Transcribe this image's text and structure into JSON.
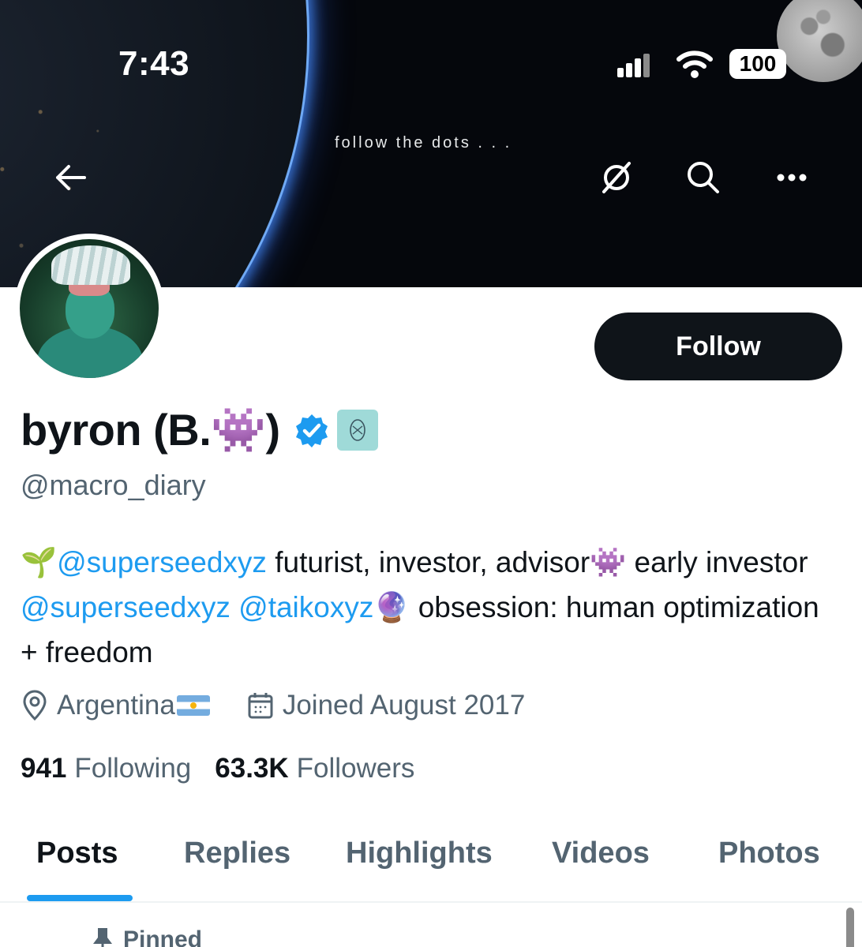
{
  "status_bar": {
    "time": "7:43",
    "battery": "100"
  },
  "banner": {
    "tagline": "follow the dots . . ."
  },
  "header": {
    "back_icon": "arrow-left-icon",
    "grok_icon": "grok-icon",
    "search_icon": "search-icon",
    "more_icon": "more-icon"
  },
  "profile": {
    "display_name": "byron (B.👾)",
    "handle": "@macro_diary",
    "follow_label": "Follow",
    "bio": {
      "seedling": "🌱",
      "mention1": "@superseedxyz",
      "text1": " futurist, investor, advisor👾 early investor ",
      "mention2": "@superseedxyz",
      "space": " ",
      "mention3": "@taikoxyz",
      "text2": "🔮 obsession: human optimization + freedom"
    },
    "location": "Argentina",
    "joined": "Joined August 2017",
    "following_count": "941",
    "following_label": "Following",
    "followers_count": "63.3K",
    "followers_label": "Followers"
  },
  "tabs": [
    {
      "label": "Posts"
    },
    {
      "label": "Replies"
    },
    {
      "label": "Highlights"
    },
    {
      "label": "Videos"
    },
    {
      "label": "Photos"
    }
  ],
  "pinned_label": "Pinned",
  "colors": {
    "accent": "#1d9bf0",
    "text_primary": "#0f1419",
    "text_secondary": "#536471"
  }
}
